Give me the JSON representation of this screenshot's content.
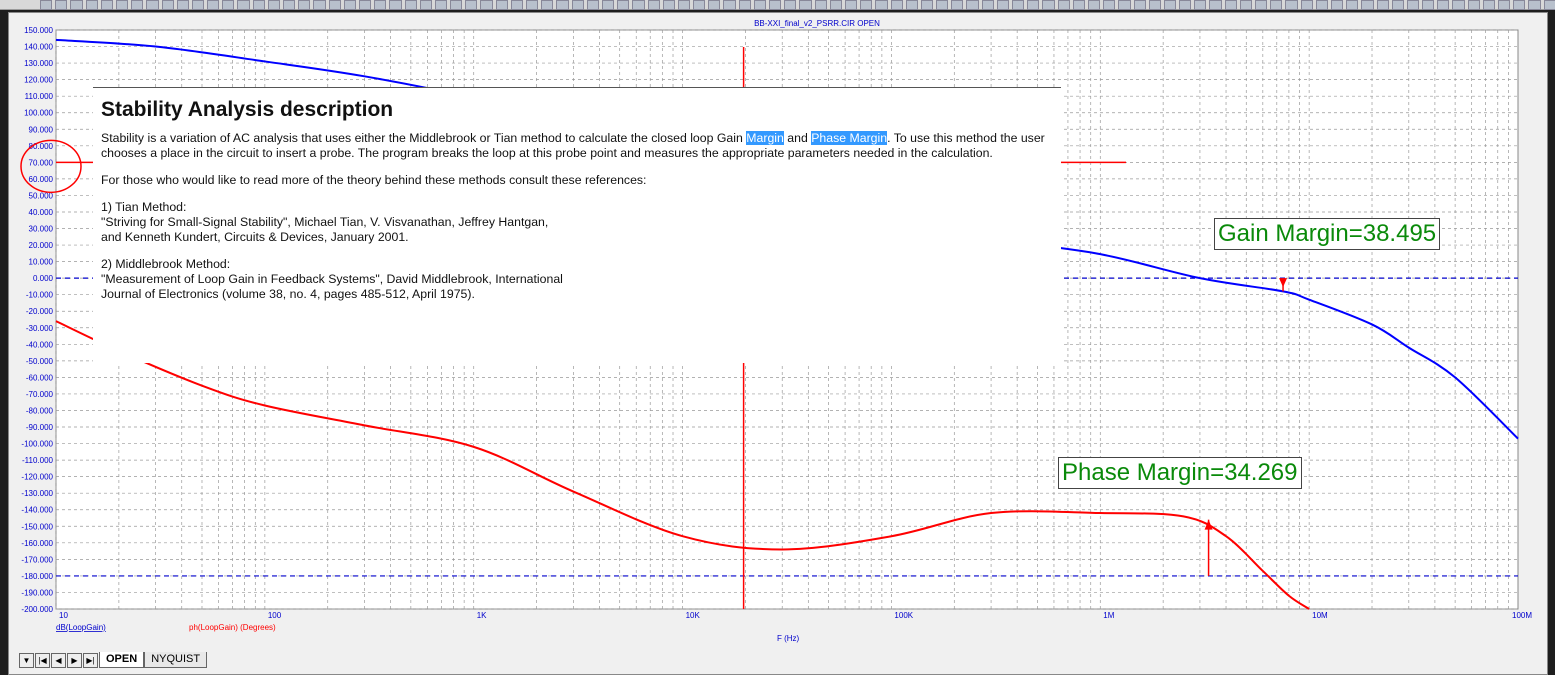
{
  "window": {
    "title": "BB-XXI_final_v2_PSRR.CIR OPEN"
  },
  "description": {
    "heading": "Stability Analysis description",
    "p1_a": "Stability is a variation of AC analysis that uses either the Middlebrook or Tian method to calculate the closed loop Gain ",
    "p1_hl1": "Margin",
    "p1_b": " and ",
    "p1_hl2": "Phase Margin",
    "p1_c": ". To use this method the user chooses a place in the circuit to insert a probe. The program breaks the loop at this probe point and measures the appropriate parameters needed in the calculation.",
    "p2": "For those who would like to read more of the theory behind these methods consult these references:",
    "ref1_title": "1) Tian Method:",
    "ref1_l1": "\"Striving for Small-Signal Stability\", Michael Tian, V. Visvanathan, Jeffrey Hantgan,",
    "ref1_l2": "and Kenneth Kundert, Circuits & Devices, January 2001.",
    "ref2_title": "2) Middlebrook Method:",
    "ref2_l1": "\"Measurement of Loop Gain in Feedback Systems\", David Middlebrook, International",
    "ref2_l2": "Journal of Electronics (volume 38, no. 4, pages 485-512, April 1975)."
  },
  "annotations": {
    "gain_margin": "Gain Margin=38.495",
    "phase_margin": "Phase Margin=34.269"
  },
  "tabs": [
    {
      "label": "OPEN",
      "active": true
    },
    {
      "label": "NYQUIST",
      "active": false
    }
  ],
  "nav_buttons": [
    "▼",
    "|◀",
    "◀",
    "▶",
    "▶|"
  ],
  "chart_data": {
    "type": "line",
    "xlabel": "F (Hz)",
    "xscale": "log",
    "xlim": [
      10,
      100000000
    ],
    "xticks": [
      {
        "v": 10,
        "label": "10"
      },
      {
        "v": 100,
        "label": "100"
      },
      {
        "v": 1000,
        "label": "1K"
      },
      {
        "v": 10000,
        "label": "10K"
      },
      {
        "v": 100000,
        "label": "100K"
      },
      {
        "v": 1000000,
        "label": "1M"
      },
      {
        "v": 10000000,
        "label": "10M"
      },
      {
        "v": 100000000,
        "label": "100M"
      }
    ],
    "ylim": [
      -200,
      150
    ],
    "ystep": 10,
    "grid": true,
    "reference_lines": [
      0,
      -180
    ],
    "cursor": {
      "x": 19600,
      "y": 70
    },
    "colors": {
      "gain": "#0000ff",
      "phase": "#ff0000",
      "annotation": "#0a8a0a",
      "cursor": "#ff0000"
    },
    "series": [
      {
        "name": "dB(LoopGain)",
        "x": [
          10,
          30,
          100,
          300,
          1000,
          3000,
          10000,
          20000,
          100000,
          300000,
          1000000,
          3000000,
          7500000,
          10000000,
          20000000,
          30000000,
          50000000,
          100000000
        ],
        "y": [
          144,
          140,
          131,
          122,
          109,
          94,
          77,
          69,
          37,
          24,
          14.5,
          0,
          -8,
          -13,
          -28,
          -42,
          -60,
          -97
        ]
      },
      {
        "name": "ph(LoopGain) (Degrees)",
        "x": [
          10,
          20,
          50,
          100,
          300,
          1000,
          3000,
          10000,
          30000,
          100000,
          300000,
          1000000,
          2500000,
          4000000,
          6000000,
          8000000,
          10000000
        ],
        "y": [
          -26,
          -44,
          -65,
          -77,
          -89,
          -102,
          -129,
          -156,
          -164,
          -156,
          -142,
          -142,
          -144,
          -156,
          -177,
          -192,
          -200
        ]
      }
    ]
  }
}
